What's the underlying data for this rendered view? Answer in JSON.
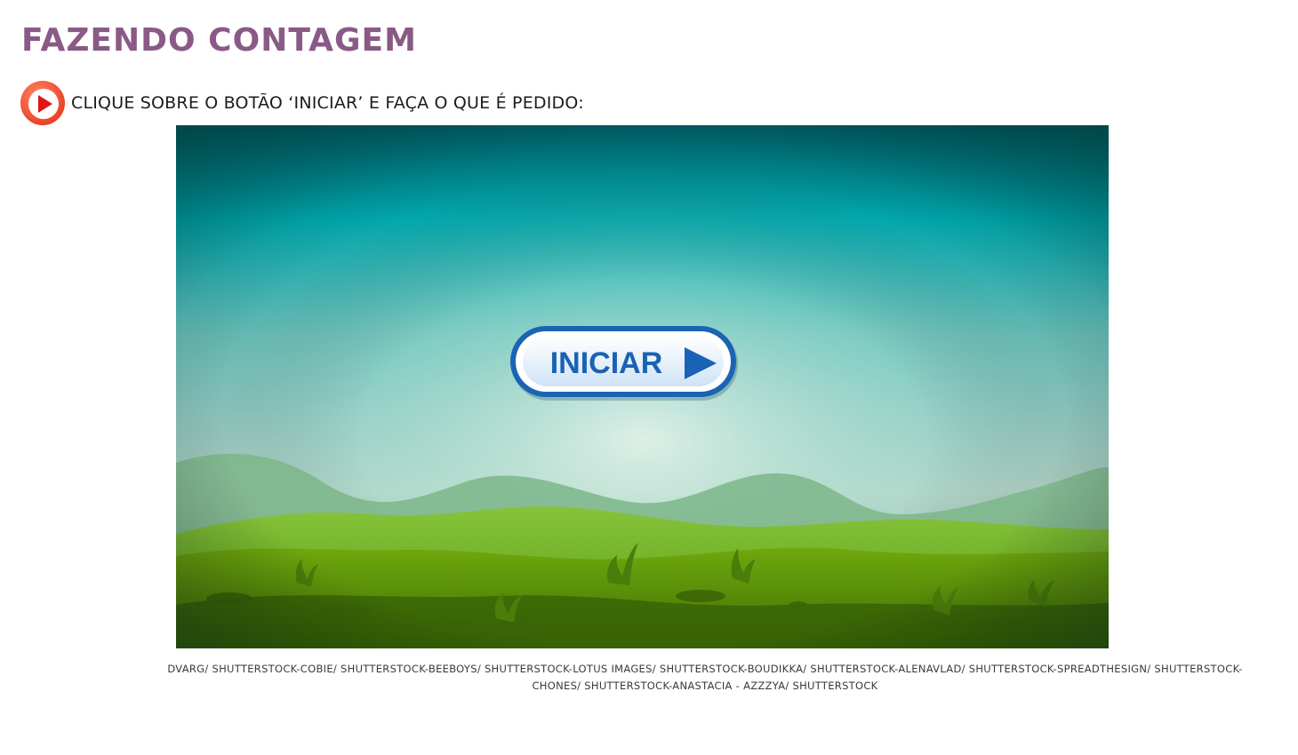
{
  "page": {
    "title": "FAZENDO CONTAGEM",
    "title_color": "#8a5a86"
  },
  "instruction": {
    "icon": "play-circle-icon",
    "text": "CLIQUE SOBRE O BOTÃO ‘INICIAR’ E FAÇA O QUE É PEDIDO:"
  },
  "game": {
    "start_button_label": "INICIAR",
    "start_button_icon": "play-triangle-icon",
    "colors": {
      "sky_top": "#006f74",
      "sky_mid": "#00b7bd",
      "sky_glow": "#cde8df",
      "hills_back": "#7fb98a",
      "grass": "#5e9a0a",
      "button_blue": "#1a64b5"
    }
  },
  "credits": {
    "line1": "DVARG/ SHUTTERSTOCK-COBIE/ SHUTTERSTOCK-BEEBOYS/ SHUTTERSTOCK-LOTUS IMAGES/ SHUTTERSTOCK-BOUDIKKA/ SHUTTERSTOCK-ALENAVLAD/ SHUTTERSTOCK-SPREADTHESIGN/ SHUTTERSTOCK-",
    "line2": "CHONES/ SHUTTERSTOCK-ANASTACIA - AZZZYA/ SHUTTERSTOCK"
  }
}
